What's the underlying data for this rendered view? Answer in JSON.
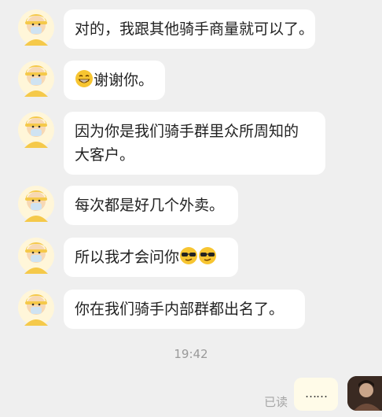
{
  "messages": [
    {
      "text": "对的，我跟其他骑手商量就可以了。"
    },
    {
      "prefix_emoji": "grin-emoji",
      "text": "谢谢你。"
    },
    {
      "lines": [
        "因为你是我们骑手群里众所周知的",
        "大客户。"
      ]
    },
    {
      "text": "每次都是好几个外卖。"
    },
    {
      "text": "所以我才会问你",
      "suffix_emoji": "sunglasses-emoji-pair"
    },
    {
      "text": "你在我们骑手内部群都出名了。"
    }
  ],
  "timestamp": "19:42",
  "my_message": {
    "text": "……",
    "status": "已读"
  },
  "colors": {
    "chat_bg": "#efefef",
    "bubble_bg": "#ffffff",
    "my_bubble_bg": "#fffbe8",
    "avatar_yellow": "#f5c94a",
    "mask_blue": "#cfe3f2"
  }
}
